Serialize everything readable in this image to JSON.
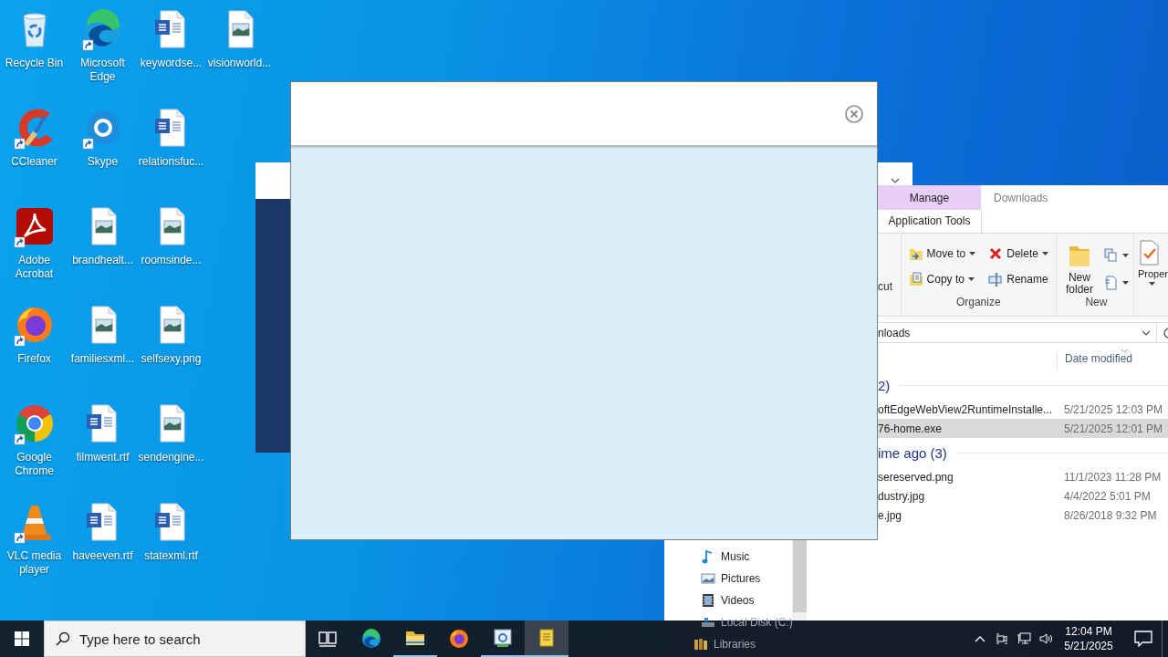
{
  "desktop": {
    "icon_columns": [
      [
        {
          "label": "Recycle Bin",
          "kind": "recycle",
          "shortcut": false
        },
        {
          "label": "CCleaner",
          "kind": "ccleaner",
          "shortcut": true
        },
        {
          "label": "Adobe Acrobat",
          "kind": "acrobat",
          "shortcut": true
        },
        {
          "label": "Firefox",
          "kind": "firefox",
          "shortcut": true
        },
        {
          "label": "Google Chrome",
          "kind": "chrome",
          "shortcut": true
        },
        {
          "label": "VLC media player",
          "kind": "vlc",
          "shortcut": true
        }
      ],
      [
        {
          "label": "Microsoft Edge",
          "kind": "edge",
          "shortcut": true
        },
        {
          "label": "Skype",
          "kind": "skype",
          "shortcut": true
        },
        {
          "label": "brandhealt...",
          "kind": "image",
          "shortcut": false
        },
        {
          "label": "familiesxml...",
          "kind": "image",
          "shortcut": false
        },
        {
          "label": "filmwent.rtf",
          "kind": "word",
          "shortcut": false
        },
        {
          "label": "haveeven.rtf",
          "kind": "word",
          "shortcut": false
        }
      ],
      [
        {
          "label": "keywordse...",
          "kind": "word",
          "shortcut": false
        },
        {
          "label": "relationsfuc...",
          "kind": "word",
          "shortcut": false
        },
        {
          "label": "roomsinde...",
          "kind": "image",
          "shortcut": false
        },
        {
          "label": "selfsexy.png",
          "kind": "image",
          "shortcut": false
        },
        {
          "label": "sendengine...",
          "kind": "image",
          "shortcut": false
        },
        {
          "label": "statexml.rtf",
          "kind": "word",
          "shortcut": false
        }
      ],
      [
        {
          "label": "visionworld...",
          "kind": "image",
          "shortcut": false
        }
      ]
    ]
  },
  "dialog": {
    "closable": true
  },
  "explorer": {
    "ribbon_tabs": [
      {
        "label": "Manage",
        "kind": "contextual"
      },
      {
        "label": "Downloads",
        "kind": "plain"
      }
    ],
    "context_label": "Application Tools",
    "ribbon": {
      "cut_label": "cut",
      "groups": [
        {
          "label": "Organize",
          "commands": [
            {
              "kind": "move",
              "label": "Move to",
              "dropdown": true
            },
            {
              "kind": "copy",
              "label": "Copy to",
              "dropdown": true
            },
            {
              "kind": "delete",
              "label": "Delete",
              "dropdown": true
            },
            {
              "kind": "rename",
              "label": "Rename",
              "dropdown": false
            }
          ]
        },
        {
          "label": "New",
          "commands": [
            {
              "kind": "new-folder",
              "label_lines": [
                "New",
                "folder"
              ],
              "dropdown": false
            },
            {
              "kind": "new-item",
              "dropdown": true
            },
            {
              "kind": "easy-access",
              "dropdown": true
            }
          ]
        }
      ],
      "properties": {
        "label": "Proper",
        "dropdown": true
      }
    },
    "address": "nloads",
    "column_header": "Date modified",
    "file_groups": [
      {
        "header": "2)",
        "rows": [
          {
            "name": "oftEdgeWebView2RuntimeInstalle...",
            "date": "5/21/2025 12:03 PM",
            "selected": false
          },
          {
            "name": "76-home.exe",
            "date": "5/21/2025 12:01 PM",
            "selected": true
          }
        ]
      },
      {
        "header": "ime ago (3)",
        "rows": [
          {
            "name": "sereserved.png",
            "date": "11/1/2023 11:28 PM",
            "selected": false
          },
          {
            "name": "dustry.jpg",
            "date": "4/4/2022 5:01 PM",
            "selected": false
          },
          {
            "name": "e.jpg",
            "date": "8/26/2018 9:32 PM",
            "selected": false
          }
        ]
      }
    ],
    "nav_pane": {
      "this_pc_items": [
        {
          "label": "Music",
          "kind": "music"
        },
        {
          "label": "Pictures",
          "kind": "pictures"
        },
        {
          "label": "Videos",
          "kind": "videos"
        },
        {
          "label": "Local Disk (C:)",
          "kind": "disk"
        }
      ],
      "top_items": [
        {
          "label": "Libraries",
          "kind": "libraries"
        }
      ]
    }
  },
  "taskbar": {
    "search_placeholder": "Type here to search",
    "apps": [
      {
        "kind": "task-view",
        "running": false,
        "active": false
      },
      {
        "kind": "edge",
        "running": false,
        "active": false
      },
      {
        "kind": "explorer",
        "running": true,
        "active": false
      },
      {
        "kind": "firefox",
        "running": false,
        "active": false
      },
      {
        "kind": "settings-app",
        "running": true,
        "active": false
      },
      {
        "kind": "notes-app",
        "running": true,
        "active": true
      }
    ],
    "clock": {
      "time": "12:04 PM",
      "date": "5/21/2025"
    }
  }
}
